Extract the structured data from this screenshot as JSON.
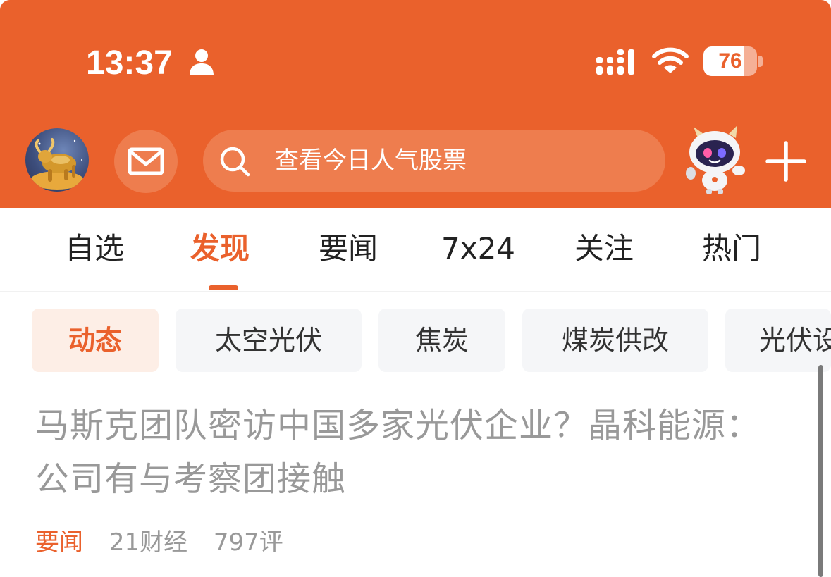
{
  "status_bar": {
    "time": "13:37",
    "battery": "76",
    "battery_level": 0.76
  },
  "header": {
    "search_placeholder": "查看今日人气股票",
    "icons": {
      "mail": "mail-icon",
      "search": "search-icon",
      "add": "plus-icon",
      "assistant": "robot-mascot-icon",
      "avatar": "golden-bull-avatar"
    }
  },
  "tabs": [
    {
      "label": "自选",
      "active": false
    },
    {
      "label": "发现",
      "active": true
    },
    {
      "label": "要闻",
      "active": false
    },
    {
      "label": "7x24",
      "active": false
    },
    {
      "label": "关注",
      "active": false
    },
    {
      "label": "热门",
      "active": false
    }
  ],
  "chips": [
    {
      "label": "动态",
      "active": true
    },
    {
      "label": "太空光伏",
      "active": false
    },
    {
      "label": "焦炭",
      "active": false
    },
    {
      "label": "煤炭供改",
      "active": false
    },
    {
      "label": "光伏设",
      "active": false
    }
  ],
  "article": {
    "title": "马斯克团队密访中国多家光伏企业？晶科能源：公司有与考察团接触",
    "tag": "要闻",
    "source": "21财经",
    "comments": "797评"
  },
  "colors": {
    "brand": "#ea612c",
    "header_control_bg": "#ee7d4e",
    "chip_active_bg": "#fdeee6",
    "chip_bg": "#f5f6f8",
    "muted_text": "#999999"
  }
}
